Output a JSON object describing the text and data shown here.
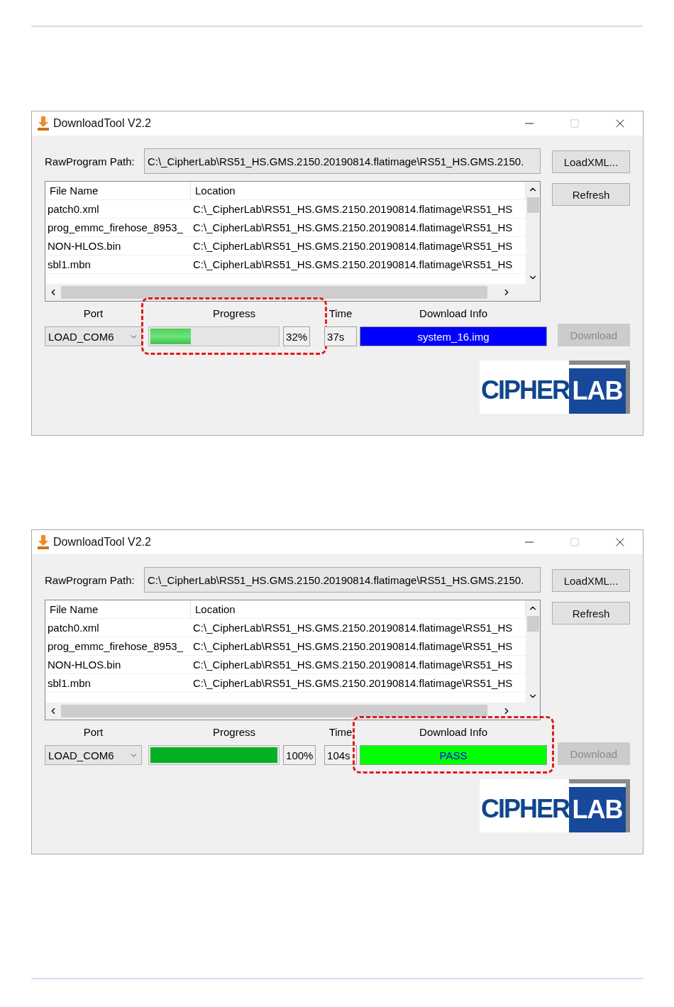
{
  "windows": [
    {
      "title": "DownloadTool V2.2",
      "path_label": "RawProgram Path:",
      "path": "C:\\_CipherLab\\RS51_HS.GMS.2150.20190814.flatimage\\RS51_HS.GMS.2150.",
      "load_button": "LoadXML...",
      "refresh_button": "Refresh",
      "download_button": {
        "label": "Download",
        "disabled": true
      },
      "table": {
        "columns": [
          "File Name",
          "Location"
        ],
        "rows": [
          {
            "file": "patch0.xml",
            "location": "C:\\_CipherLab\\RS51_HS.GMS.2150.20190814.flatimage\\RS51_HS"
          },
          {
            "file": "prog_emmc_firehose_8953_",
            "location": "C:\\_CipherLab\\RS51_HS.GMS.2150.20190814.flatimage\\RS51_HS"
          },
          {
            "file": "NON-HLOS.bin",
            "location": "C:\\_CipherLab\\RS51_HS.GMS.2150.20190814.flatimage\\RS51_HS"
          },
          {
            "file": "sbl1.mbn",
            "location": "C:\\_CipherLab\\RS51_HS.GMS.2150.20190814.flatimage\\RS51_HS"
          }
        ]
      },
      "headers": {
        "port": "Port",
        "progress": "Progress",
        "time": "Time",
        "info": "Download Info"
      },
      "port": "LOAD_COM6",
      "progress": {
        "level": 0.32,
        "percent": "32%",
        "highlighted": true
      },
      "time": "37s",
      "info": {
        "text": "system_16.img",
        "kind": "busy",
        "highlighted": false
      },
      "logo": {
        "left": "CIPHER",
        "right": "LAB"
      }
    },
    {
      "title": "DownloadTool V2.2",
      "path_label": "RawProgram Path:",
      "path": "C:\\_CipherLab\\RS51_HS.GMS.2150.20190814.flatimage\\RS51_HS.GMS.2150.",
      "load_button": "LoadXML...",
      "refresh_button": "Refresh",
      "download_button": {
        "label": "Download",
        "disabled": true
      },
      "table": {
        "columns": [
          "File Name",
          "Location"
        ],
        "rows": [
          {
            "file": "patch0.xml",
            "location": "C:\\_CipherLab\\RS51_HS.GMS.2150.20190814.flatimage\\RS51_HS"
          },
          {
            "file": "prog_emmc_firehose_8953_",
            "location": "C:\\_CipherLab\\RS51_HS.GMS.2150.20190814.flatimage\\RS51_HS"
          },
          {
            "file": "NON-HLOS.bin",
            "location": "C:\\_CipherLab\\RS51_HS.GMS.2150.20190814.flatimage\\RS51_HS"
          },
          {
            "file": "sbl1.mbn",
            "location": "C:\\_CipherLab\\RS51_HS.GMS.2150.20190814.flatimage\\RS51_HS"
          }
        ]
      },
      "headers": {
        "port": "Port",
        "progress": "Progress",
        "time": "Time",
        "info": "Download Info"
      },
      "port": "LOAD_COM6",
      "progress": {
        "level": 1.0,
        "percent": "100%",
        "highlighted": false
      },
      "time": "104s",
      "info": {
        "text": "PASS",
        "kind": "pass",
        "highlighted": true
      },
      "logo": {
        "left": "CIPHER",
        "right": "LAB"
      }
    }
  ]
}
